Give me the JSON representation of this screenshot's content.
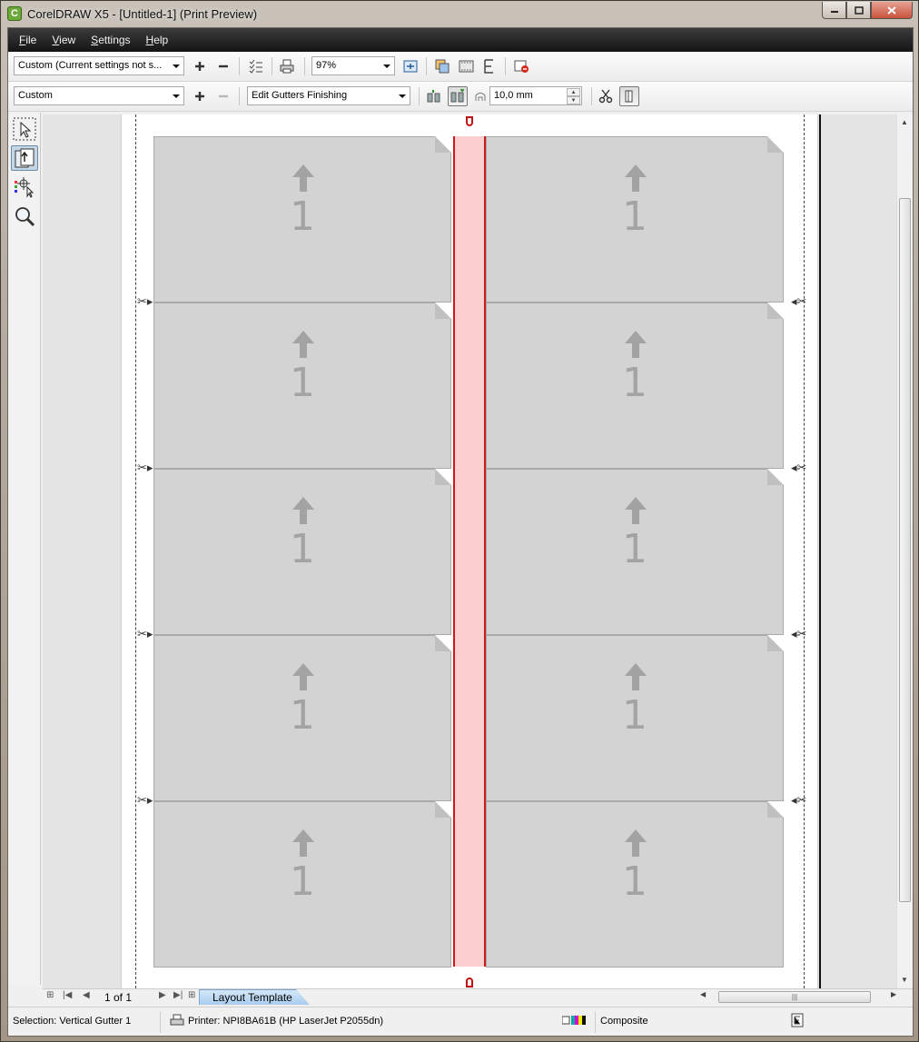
{
  "window": {
    "title": "CorelDRAW X5 - [Untitled-1] (Print Preview)",
    "app_icon_glyph": "C"
  },
  "menu": {
    "items": [
      {
        "mnemonic": "F",
        "rest": "ile"
      },
      {
        "mnemonic": "V",
        "rest": "iew"
      },
      {
        "mnemonic": "S",
        "rest": "ettings"
      },
      {
        "mnemonic": "H",
        "rest": "elp"
      }
    ]
  },
  "toolbar1": {
    "print_style": "Custom (Current settings not s...",
    "zoom": "97%"
  },
  "toolbar2": {
    "layout_preset": "Custom",
    "edit_mode": "Edit Gutters  Finishing",
    "gutter_value": "10,0 mm"
  },
  "layout": {
    "cell_number": "1",
    "rows": 5,
    "columns": 2
  },
  "pagebar": {
    "page_count": "1 of 1",
    "tab_label": "Layout Template"
  },
  "status": {
    "selection": "Selection: Vertical Gutter 1",
    "printer": "Printer: NPI8BA61B (HP LaserJet P2055dn)",
    "mode": "Composite"
  },
  "colors": {
    "gutter_fill": "#fbcfcf",
    "gutter_border": "#d01818",
    "cell_fill": "#d3d3d3"
  }
}
